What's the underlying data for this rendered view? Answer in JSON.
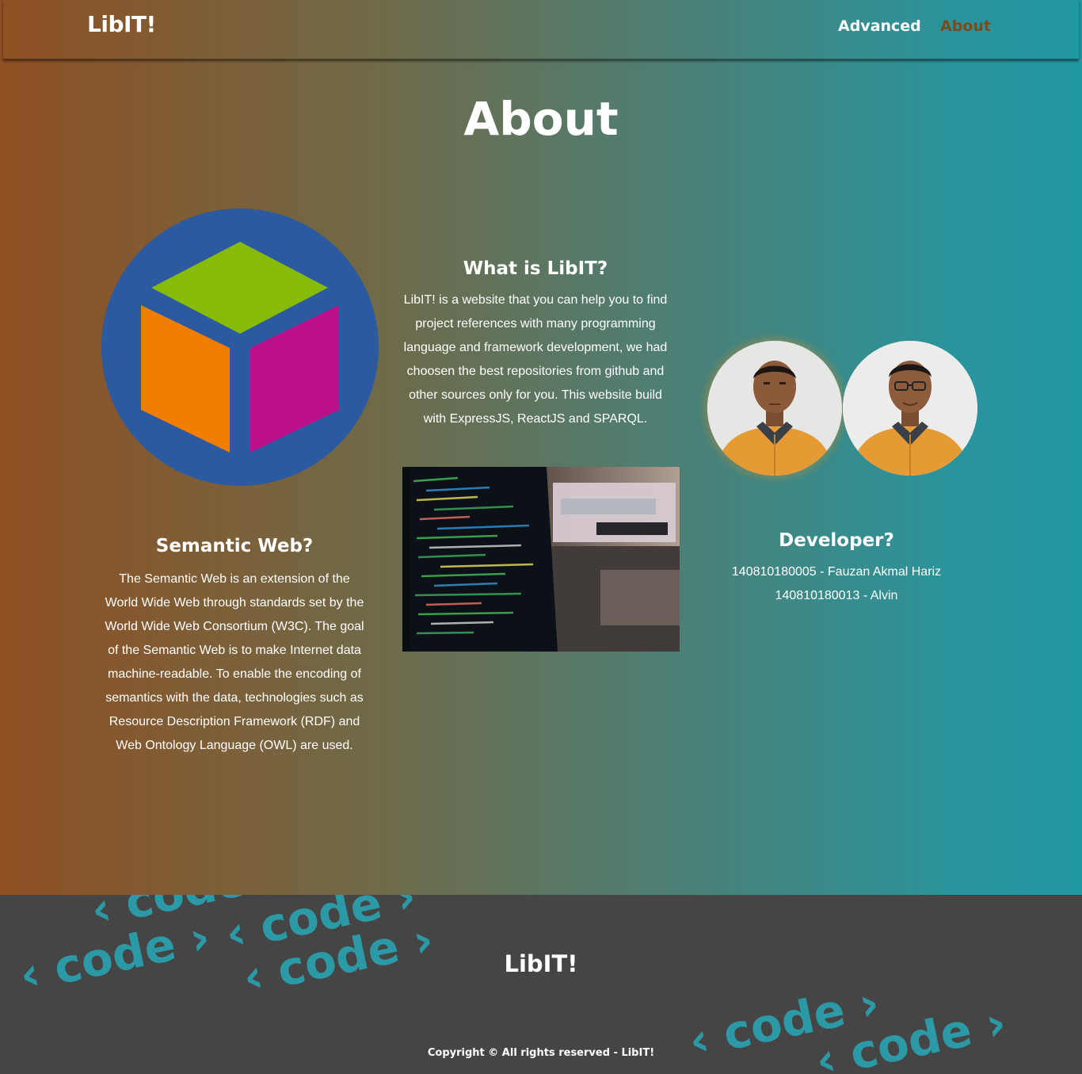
{
  "colors": {
    "gradient_left": "#8f5023",
    "gradient_right": "#2298a3",
    "active_nav": "#7b4a1d",
    "footer_bg": "#454545",
    "code_deco": "#2b9aa6"
  },
  "navbar": {
    "brand": "LibIT!",
    "links": [
      {
        "label": "Advanced",
        "active": false
      },
      {
        "label": "About",
        "active": true
      }
    ]
  },
  "page": {
    "title": "About"
  },
  "semantic_logo": {
    "icon": "semantic-web-cube-logo"
  },
  "what_is": {
    "heading": "What is LibIT?",
    "lines": [
      "LibIT! is a website that you can help you to find",
      "project references with many programming",
      "language and framework development, we had",
      "choosen the best repositories from github and",
      "other sources only for you. This website build",
      "with ExpressJS, ReactJS and SPARQL."
    ]
  },
  "code_image": {
    "icon": "code-screen-photo"
  },
  "semantic_web": {
    "heading": "Semantic Web?",
    "lines": [
      "The Semantic Web is an extension of the",
      "World Wide Web through standards set by the",
      "World Wide Web Consortium (W3C). The goal",
      "of the Semantic Web is to make Internet data",
      "machine-readable. To enable the encoding of",
      "semantics with the data, technologies such as",
      "Resource Description Framework (RDF) and",
      "Web Ontology Language (OWL) are used."
    ]
  },
  "developer": {
    "heading": "Developer?",
    "lines": [
      "140810180005 - Fauzan Akmal Hariz",
      "140810180013 - Alvin"
    ]
  },
  "footer": {
    "brand": "LibIT!",
    "copyright": "Copyright © All rights reserved - LibIT!",
    "decoration_text": "‹ code ›"
  }
}
